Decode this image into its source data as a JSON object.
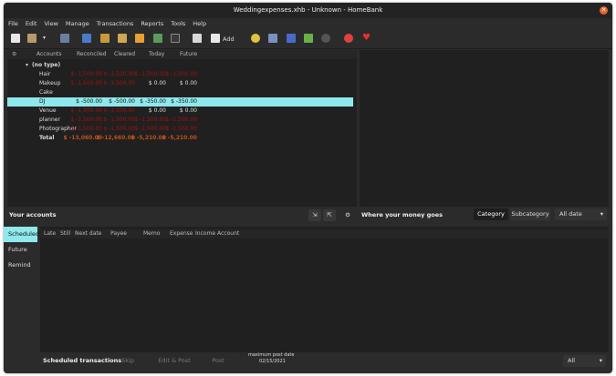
{
  "window": {
    "title": "Weddingexpenses.xhb - Unknown - HomeBank"
  },
  "menu": [
    "File",
    "Edit",
    "View",
    "Manage",
    "Transactions",
    "Reports",
    "Tools",
    "Help"
  ],
  "toolbar": {
    "add_label": "Add",
    "icons": [
      "new-file-icon",
      "open-file-icon",
      "open-dropdown-icon",
      "save-icon",
      "accounts-icon",
      "payees-icon",
      "categories-icon",
      "budget-icon",
      "archive-icon",
      "assign-icon",
      "show-transactions-icon",
      "add-transaction-icon",
      "statistics-icon",
      "trend-icon",
      "balance-icon",
      "budget-report-icon",
      "vehicle-icon",
      "help-icon",
      "donate-icon"
    ]
  },
  "accounts": {
    "columns": [
      "Accounts",
      "Reconciled",
      "Cleared",
      "Today",
      "Future"
    ],
    "group": "(no type)",
    "rows": [
      {
        "name": "Hair",
        "reconciled": "$ -1,500.00",
        "cleared": "$ -1,500.00",
        "today": "$ -1,500.00",
        "future": "$ -1,500.00"
      },
      {
        "name": "Makeup",
        "reconciled": "$ -1,500.00",
        "cleared": "$ -1,500.00",
        "today": "$ 0.00",
        "future": "$ 0.00"
      },
      {
        "name": "Cake",
        "reconciled": "",
        "cleared": "",
        "today": "",
        "future": ""
      },
      {
        "name": "DJ",
        "reconciled": "$ -500.00",
        "cleared": "$ -500.00",
        "today": "$ -350.00",
        "future": "$ -350.00"
      },
      {
        "name": "Venue",
        "reconciled": "$ -1,500.00",
        "cleared": "$ -1,500.00",
        "today": "$ 0.00",
        "future": "$ 0.00"
      },
      {
        "name": "planner",
        "reconciled": "$ -1,500.00",
        "cleared": "$ -1,500.00",
        "today": "$ -1,500.00",
        "future": "$ -1,500.00"
      },
      {
        "name": "Photographer",
        "reconciled": "$ -1,500.00",
        "cleared": "$ -1,500.00",
        "today": "$ -1,500.00",
        "future": "$ -1,500.00"
      }
    ],
    "total": {
      "name": "Total",
      "reconciled": "$ -13,060.00",
      "cleared": "$ -12,660.00",
      "today": "$ -5,210.00",
      "future": "$ -5,210.00"
    },
    "footer_label": "Your accounts"
  },
  "money": {
    "label": "Where your money goes",
    "tab_category": "Category",
    "tab_subcategory": "Subcategory",
    "range": "All date"
  },
  "scheduled": {
    "side": [
      "Scheduled",
      "Future",
      "Remind"
    ],
    "columns": [
      "Late",
      "Still",
      "Next date",
      "Payee",
      "Memo",
      "Expense",
      "Income",
      "Account"
    ],
    "footer_label": "Scheduled transactions",
    "skip": "Skip",
    "edit_post": "Edit & Post",
    "post": "Post",
    "max_post_label": "maximum post date",
    "max_post_date": "02/15/2021",
    "filter": "All"
  },
  "colors": {
    "selection": "#8ee8ec",
    "negative": "#a31010",
    "total_negative": "#c0511a"
  }
}
